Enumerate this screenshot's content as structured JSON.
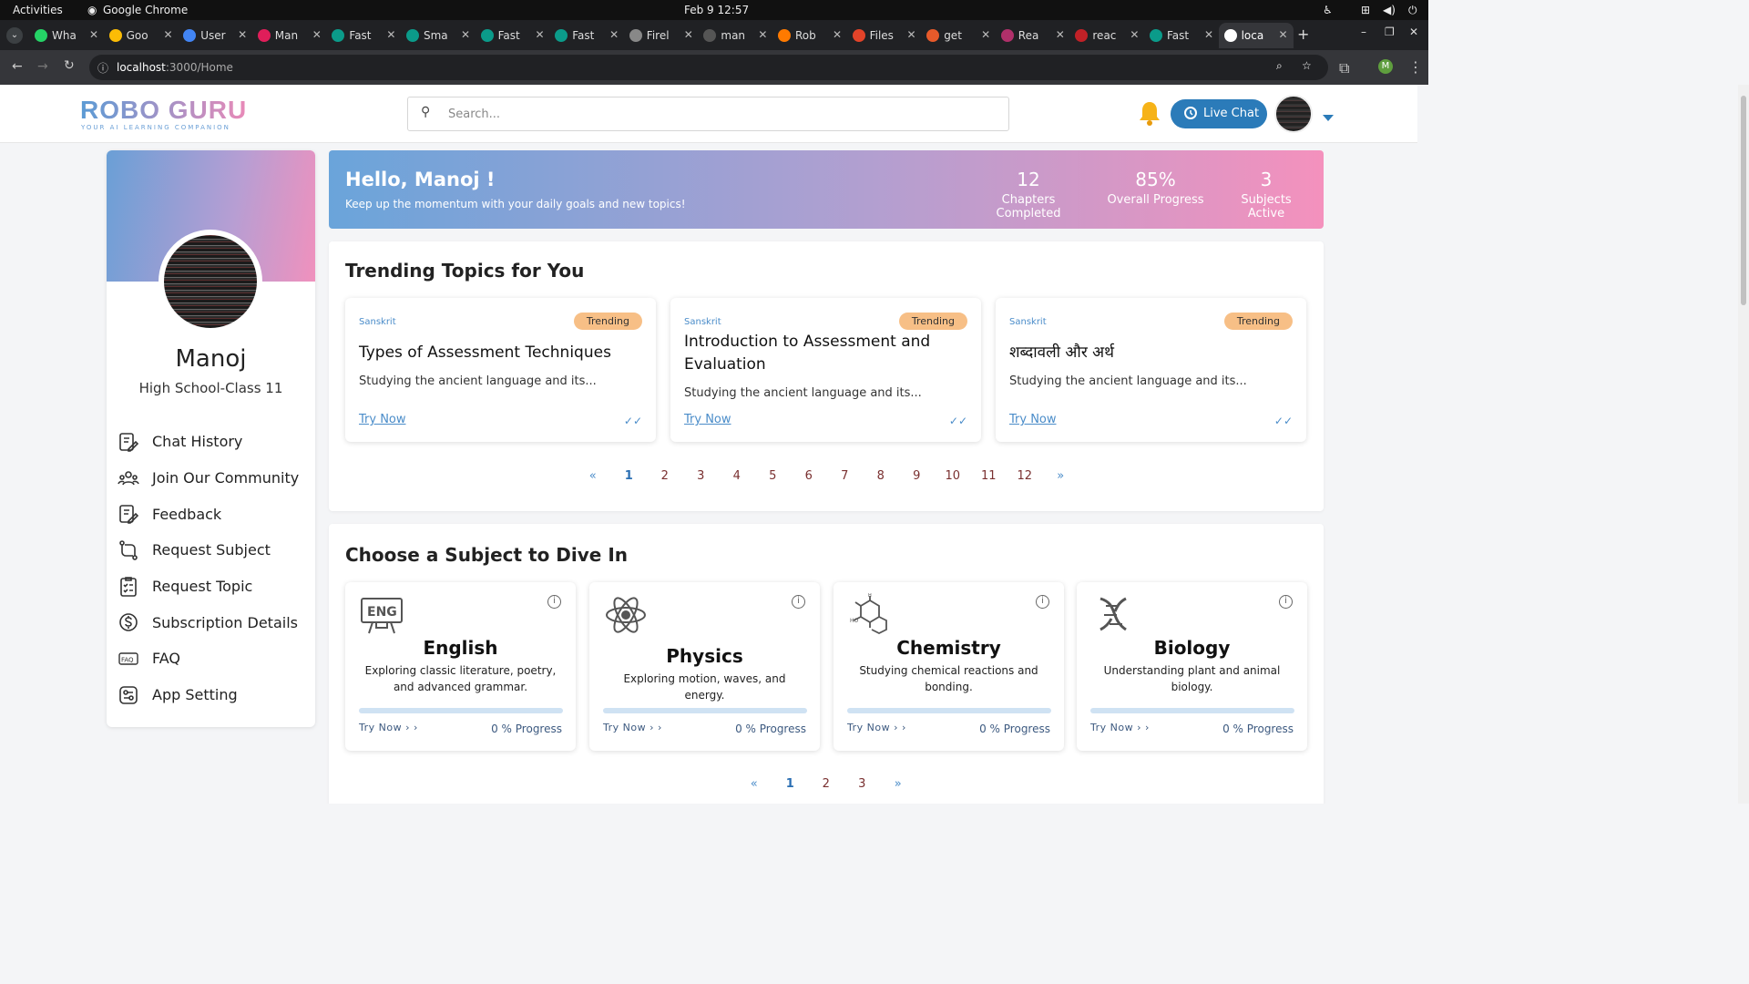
{
  "os": {
    "activities": "Activities",
    "app": "Google Chrome",
    "clock": "Feb 9  12:57"
  },
  "tabs": [
    {
      "label": "Wha",
      "color": "#25d366"
    },
    {
      "label": "Goo",
      "color": "#fbbc05"
    },
    {
      "label": "User",
      "color": "#4285f4"
    },
    {
      "label": "Man",
      "color": "#e01e5a"
    },
    {
      "label": "Fast",
      "color": "#0b9b8a"
    },
    {
      "label": "Sma",
      "color": "#0b9b8a"
    },
    {
      "label": "Fast",
      "color": "#0b9b8a"
    },
    {
      "label": "Fast",
      "color": "#0b9b8a"
    },
    {
      "label": "Firel",
      "color": "#888888"
    },
    {
      "label": "man",
      "color": "#555555"
    },
    {
      "label": "Rob",
      "color": "#ff7a00"
    },
    {
      "label": "Files",
      "color": "#e24329"
    },
    {
      "label": "get",
      "color": "#e85a2a"
    },
    {
      "label": "Rea",
      "color": "#b0306a"
    },
    {
      "label": "reac",
      "color": "#c12127"
    },
    {
      "label": "Fast",
      "color": "#0b9b8a"
    },
    {
      "label": "loca",
      "color": "#ffffff"
    }
  ],
  "browser": {
    "url_host": "localhost",
    "url_path": ":3000/Home"
  },
  "header": {
    "logo": "ROBO GURU",
    "logo_sub": "YOUR AI LEARNING COMPANION",
    "search_placeholder": "Search...",
    "live_chat": "Live Chat"
  },
  "profile": {
    "name": "Manoj",
    "class": "High School-Class 11"
  },
  "menu": [
    "Chat History",
    "Join Our Community",
    "Feedback",
    "Request Subject",
    "Request Topic",
    "Subscription Details",
    "FAQ",
    "App Setting"
  ],
  "hero": {
    "greeting": "Hello, Manoj !",
    "subtitle": "Keep up the momentum with your daily goals and new topics!",
    "stats": [
      {
        "value": "12",
        "label": "Chapters Completed"
      },
      {
        "value": "85%",
        "label": "Overall Progress"
      },
      {
        "value": "3",
        "label": "Subjects Active"
      }
    ]
  },
  "trending": {
    "title": "Trending Topics for You",
    "cards": [
      {
        "subject": "Sanskrit",
        "badge": "Trending",
        "title": "Types of Assessment Techniques",
        "desc": "Studying the ancient language and its...",
        "cta": "Try Now"
      },
      {
        "subject": "Sanskrit",
        "badge": "Trending",
        "title": "Introduction to Assessment and Evaluation",
        "desc": "Studying the ancient language and its...",
        "cta": "Try Now"
      },
      {
        "subject": "Sanskrit",
        "badge": "Trending",
        "title": "शब्दावली और अर्थ",
        "desc": "Studying the ancient language and its...",
        "cta": "Try Now"
      }
    ],
    "pages": [
      "«",
      "1",
      "2",
      "3",
      "4",
      "5",
      "6",
      "7",
      "8",
      "9",
      "10",
      "11",
      "12",
      "»"
    ]
  },
  "subjects": {
    "title": "Choose a Subject to Dive In",
    "cards": [
      {
        "name": "English",
        "desc": "Exploring classic literature, poetry, and advanced grammar.",
        "cta": "Try Now",
        "progress": "0 %  Progress",
        "progress_value": 0
      },
      {
        "name": "Physics",
        "desc": "Exploring motion, waves, and energy.",
        "cta": "Try Now",
        "progress": "0 %  Progress",
        "progress_value": 0
      },
      {
        "name": "Chemistry",
        "desc": "Studying chemical reactions and bonding.",
        "cta": "Try Now",
        "progress": "0 %  Progress",
        "progress_value": 0
      },
      {
        "name": "Biology",
        "desc": "Understanding plant and animal biology.",
        "cta": "Try Now",
        "progress": "0 %  Progress",
        "progress_value": 0
      }
    ],
    "pages": [
      "«",
      "1",
      "2",
      "3",
      "»"
    ]
  }
}
